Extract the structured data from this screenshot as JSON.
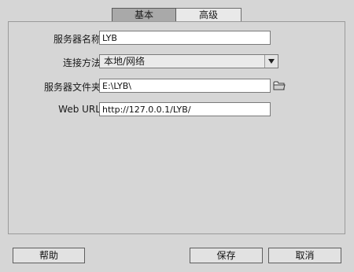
{
  "tabs": {
    "basic_label": "基本",
    "advanced_label": "高级"
  },
  "form": {
    "server_name_label": "服务器名称:",
    "server_name_value": "LYB",
    "connect_method_label": "连接方法:",
    "connect_method_value": "本地/网络",
    "server_folder_label": "服务器文件夹:",
    "server_folder_value": "E:\\LYB\\",
    "web_url_label": "Web URL:",
    "web_url_value": "http://127.0.0.1/LYB/"
  },
  "icons": {
    "dropdown": "chevron-down-icon",
    "browse": "folder-icon"
  },
  "buttons": {
    "help_label": "帮助",
    "save_label": "保存",
    "cancel_label": "取消"
  }
}
